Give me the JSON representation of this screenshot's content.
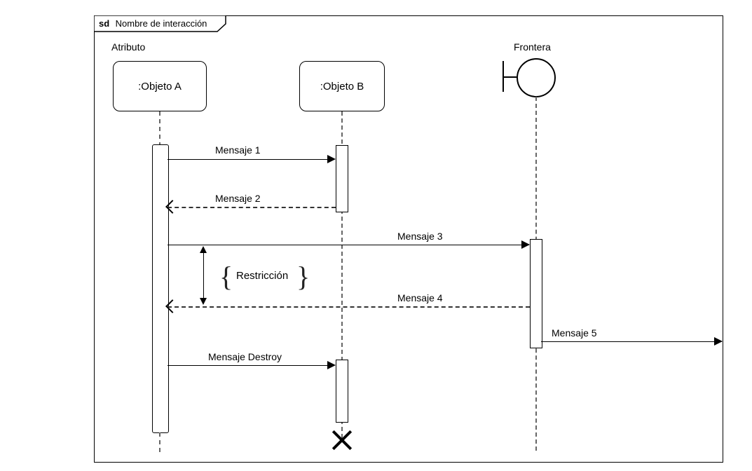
{
  "frame": {
    "tag": "sd",
    "name": "Nombre de interacción"
  },
  "labels": {
    "attribute": "Atributo",
    "frontier": "Frontera",
    "constraint": "Restricción"
  },
  "objects": {
    "a": ":Objeto A",
    "b": ":Objeto B"
  },
  "messages": {
    "m1": "Mensaje 1",
    "m2": "Mensaje 2",
    "m3": "Mensaje 3",
    "m4": "Mensaje 4",
    "m5": "Mensaje 5",
    "destroy": "Mensaje Destroy"
  }
}
